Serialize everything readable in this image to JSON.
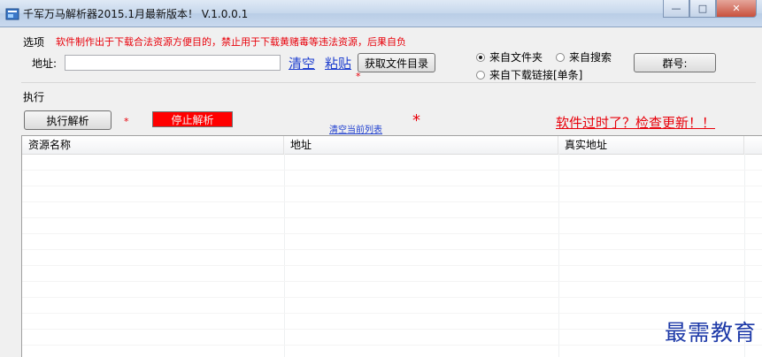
{
  "window": {
    "title": "千军万马解析器2015.1月最新版本！ V.1.0.0.1",
    "buttons": {
      "minimize": "—",
      "maximize": "□",
      "close": "✕"
    }
  },
  "options": {
    "section_label": "选项",
    "disclaimer": "软件制作出于下载合法资源方便目的，禁止用于下载黄赌毒等违法资源，后果自负",
    "address_label": "地址:",
    "address_value": "",
    "clear_link": "清空",
    "paste_link": "粘贴",
    "get_dir_button": "获取文件目录",
    "star": "*",
    "radios": {
      "from_folder": "来自文件夹",
      "from_search": "来自搜索",
      "from_download_link": "来自下载链接[单条]",
      "selected": "from_folder"
    },
    "group_button": "群号:"
  },
  "execute": {
    "section_label": "执行",
    "run_button": "执行解析",
    "star": "*",
    "stop_button": "停止解析",
    "clear_list_link": "清空当前列表",
    "big_star": "*",
    "update_link": "软件过时了？检查更新！！"
  },
  "list": {
    "columns": [
      "资源名称",
      "地址",
      "真实地址"
    ]
  },
  "watermark": "最需教育",
  "colors": {
    "red": "#e8000a",
    "link_blue": "#1f3fcf",
    "stop_bg": "#ff0000"
  }
}
